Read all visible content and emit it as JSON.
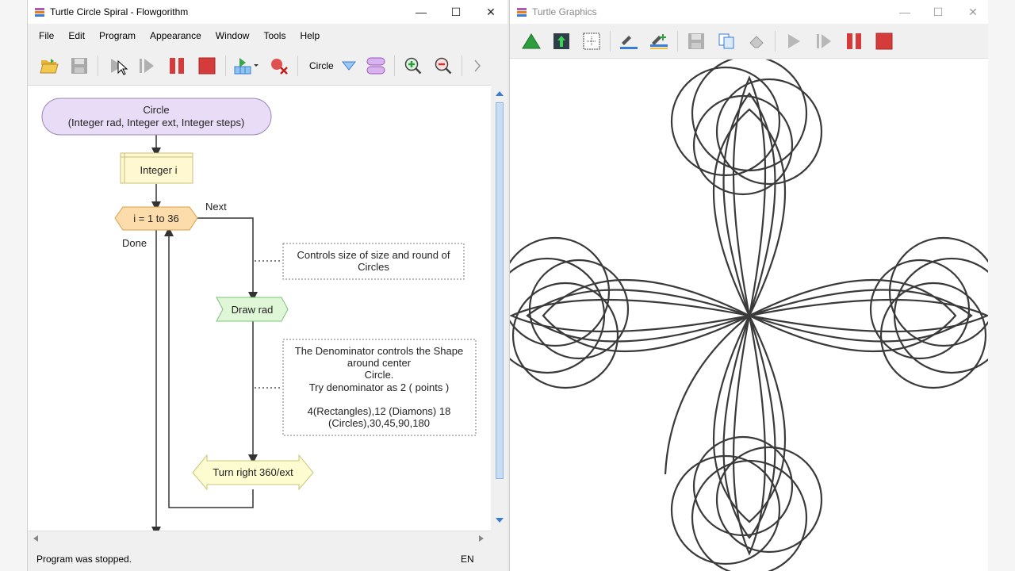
{
  "flowgorithm": {
    "title": "Turtle Circle  Spiral - Flowgorithm",
    "menu": [
      "File",
      "Edit",
      "Program",
      "Appearance",
      "Window",
      "Tools",
      "Help"
    ],
    "toolbar": {
      "function_name": "Circle"
    },
    "flowchart": {
      "start_line1": "Circle",
      "start_line2": "(Integer rad, Integer ext, Integer steps)",
      "declare": "Integer i",
      "loop": "i = 1 to 36",
      "next_label": "Next",
      "done_label": "Done",
      "comment1_line1": "Controls size of size and round of",
      "comment1_line2": "Circles",
      "call": "Draw rad",
      "comment2_line1": "The Denominator controls the Shape",
      "comment2_line2": "around center",
      "comment2_line3": "Circle.",
      "comment2_line4": "Try denominator as 2 ( points )",
      "comment2_line5": "4(Rectangles),12 (Diamons) 18",
      "comment2_line6": "(Circles),30,45,90,180",
      "turn": "Turn right 360/ext"
    },
    "status": "Program was stopped.",
    "language": "EN"
  },
  "turtle": {
    "title": "Turtle Graphics"
  },
  "colors": {
    "terminal_fill": "#e8dcf7",
    "declare_fill": "#fff8d0",
    "loop_fill": "#fbdcaa",
    "call_fill": "#dff7d6",
    "turn_fill": "#fdfbd0",
    "stop_red": "#d9534f"
  }
}
